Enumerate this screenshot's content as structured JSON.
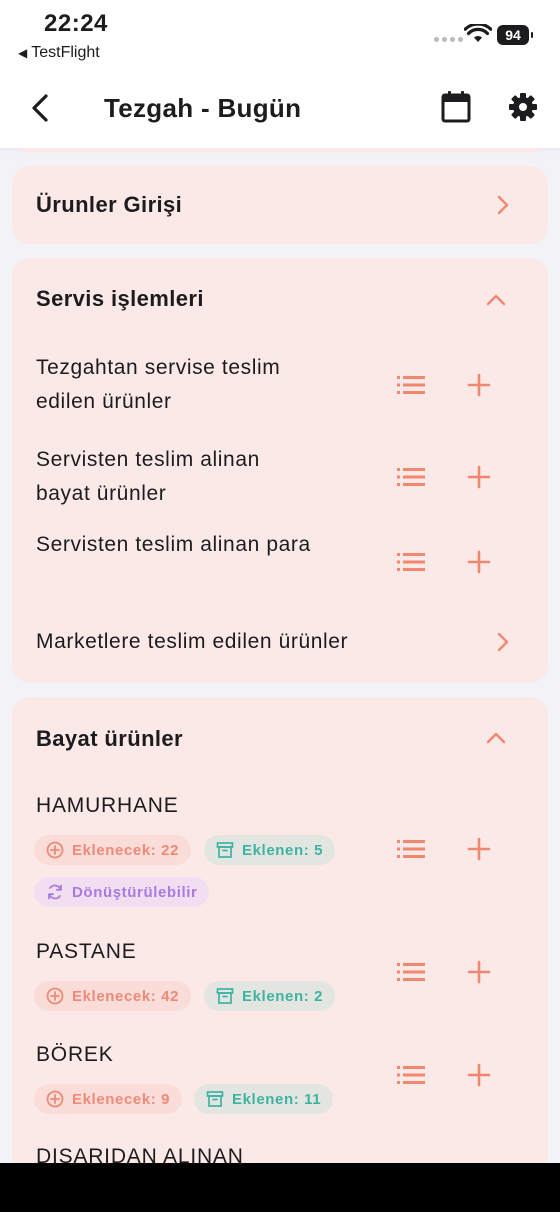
{
  "status_bar": {
    "time": "22:24",
    "back_app": "TestFlight",
    "battery": "94"
  },
  "nav": {
    "title": "Tezgah - Bugün",
    "icons": [
      "chevron-left-icon",
      "calendar-icon",
      "gear-icon"
    ]
  },
  "products_entry": {
    "title": "Ürunler Girişi"
  },
  "service": {
    "title": "Servis işlemleri",
    "rows": [
      {
        "line1": "Tezgahtan servise teslim",
        "line2": "edilen ürünler"
      },
      {
        "line1": "Servisten teslim alinan",
        "line2": "bayat ürünler"
      },
      {
        "line1": "Servisten teslim alinan para",
        "line2": ""
      }
    ],
    "markets": "Marketlere teslim edilen ürünler"
  },
  "stale": {
    "title": "Bayat ürünler",
    "items": [
      {
        "name": "HAMURHANE",
        "pending": "Eklenecek: 22",
        "added": "Eklenen: 5",
        "convert": "Dönüştürülebilir"
      },
      {
        "name": "PASTANE",
        "pending": "Eklenecek: 42",
        "added": "Eklenen: 2"
      },
      {
        "name": "BÖREK",
        "pending": "Eklenecek: 9",
        "added": "Eklenen: 11"
      },
      {
        "name": "DIŞARIDAN ALINAN"
      }
    ]
  },
  "colors": {
    "accent": "#f0876f",
    "card_bg": "#fbe9e8",
    "pending_bg": "#fadcd8",
    "added_text": "#3fb3a3",
    "convert_text": "#a97ae0"
  }
}
